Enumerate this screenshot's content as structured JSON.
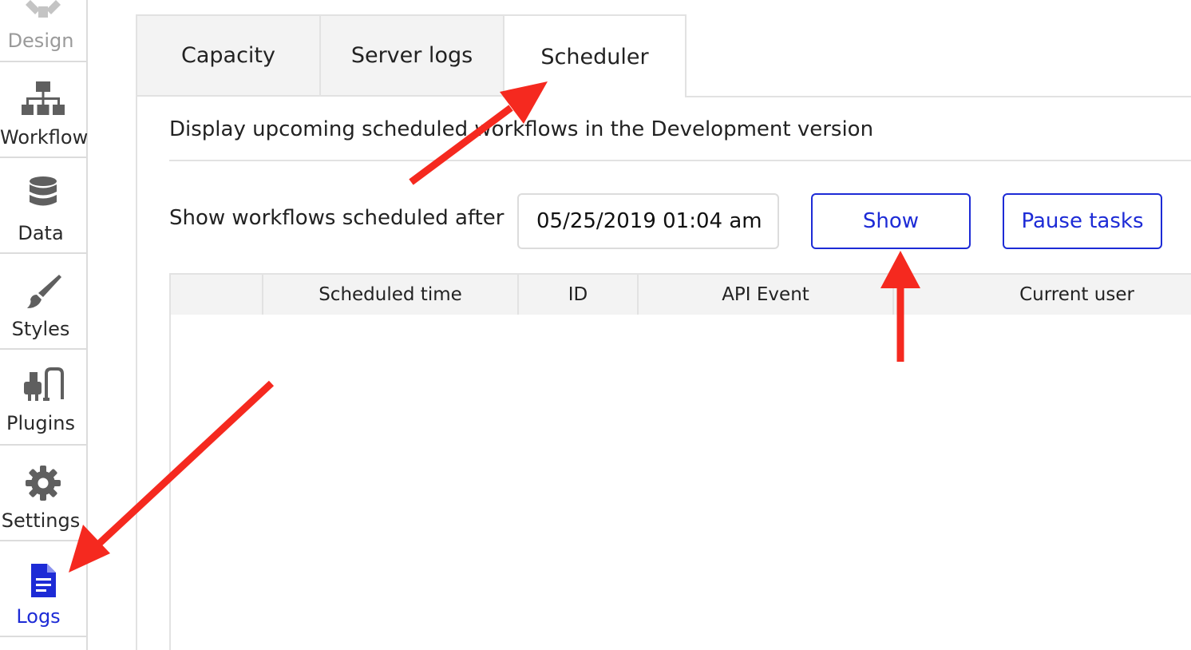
{
  "sidebar": {
    "items": [
      {
        "label": "Design",
        "icon": "design-icon",
        "state": "faded"
      },
      {
        "label": "Workflow",
        "icon": "workflow-icon",
        "state": "normal"
      },
      {
        "label": "Data",
        "icon": "database-icon",
        "state": "normal"
      },
      {
        "label": "Styles",
        "icon": "brush-icon",
        "state": "normal"
      },
      {
        "label": "Plugins",
        "icon": "plug-icon",
        "state": "normal"
      },
      {
        "label": "Settings",
        "icon": "gear-icon",
        "state": "normal"
      },
      {
        "label": "Logs",
        "icon": "document-icon",
        "state": "active"
      }
    ]
  },
  "tabs": [
    {
      "label": "Capacity",
      "active": false
    },
    {
      "label": "Server logs",
      "active": false
    },
    {
      "label": "Scheduler",
      "active": true
    }
  ],
  "scheduler": {
    "heading": "Display upcoming scheduled workflows in the Development version",
    "filter_label": "Show workflows scheduled after",
    "date_value": "05/25/2019 01:04 am",
    "show_button": "Show",
    "pause_button": "Pause tasks"
  },
  "table": {
    "columns": [
      "",
      "Scheduled time",
      "ID",
      "API Event",
      "Current user"
    ],
    "rows": []
  },
  "colors": {
    "accent": "#1d2bd6",
    "annotation_arrow": "#f5291f",
    "icon_gray": "#5f5f5f",
    "border": "#e2e2e2"
  }
}
